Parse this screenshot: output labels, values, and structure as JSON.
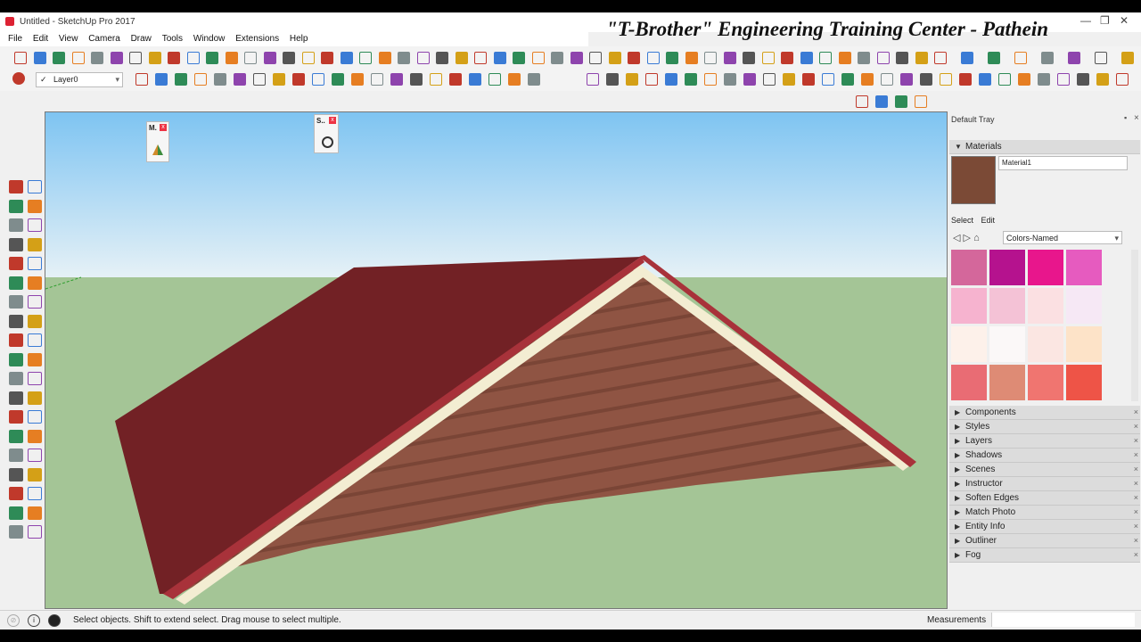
{
  "window": {
    "title": "Untitled - SketchUp Pro 2017",
    "minimize": "—",
    "restore": "❐",
    "close": "✕"
  },
  "overlay_text": "\"T-Brother\" Engineering Training Center - Pathein",
  "menu": [
    "File",
    "Edit",
    "View",
    "Camera",
    "Draw",
    "Tools",
    "Window",
    "Extensions",
    "Help"
  ],
  "layer_toolbar": {
    "checkmark": "✓",
    "current_layer": "Layer0",
    "dropdown": "▾"
  },
  "mini_toolbars": [
    {
      "label": "M.",
      "close": "x"
    },
    {
      "label": "S..",
      "close": "x"
    }
  ],
  "tray": {
    "title": "Default Tray",
    "pin": "▪",
    "close": "×",
    "materials": {
      "header": "Materials",
      "current_material": "Material1",
      "tab_select": "Select",
      "tab_edit": "Edit",
      "library": "Colors-Named",
      "dropdown": "▾",
      "swatches": [
        "#d4679b",
        "#b5128e",
        "#e8168c",
        "#e65bbf",
        "#f6b3cf",
        "#f4c2d6",
        "#fbe0e2",
        "#f6e8f5",
        "#fdf1ea",
        "#fbf8f8",
        "#fbe6e2",
        "#fde3c8",
        "#e96c74",
        "#de8b75",
        "#f07570",
        "#ee5447"
      ]
    },
    "panels": [
      "Components",
      "Styles",
      "Layers",
      "Shadows",
      "Scenes",
      "Instructor",
      "Soften Edges",
      "Match Photo",
      "Entity Info",
      "Outliner",
      "Fog"
    ],
    "panel_arrow": "▶",
    "panel_close": "×"
  },
  "status": {
    "message": "Select objects. Shift to extend select. Drag mouse to select multiple.",
    "measurements_label": "Measurements"
  },
  "colors": {
    "sky_top": "#7ec4f2",
    "sky_bottom": "#e6f1f6",
    "ground": "#a4c596",
    "roof": "#722125",
    "roof_edge": "#a8323a",
    "gable": "#8f5443",
    "trim": "#f3edd2"
  }
}
